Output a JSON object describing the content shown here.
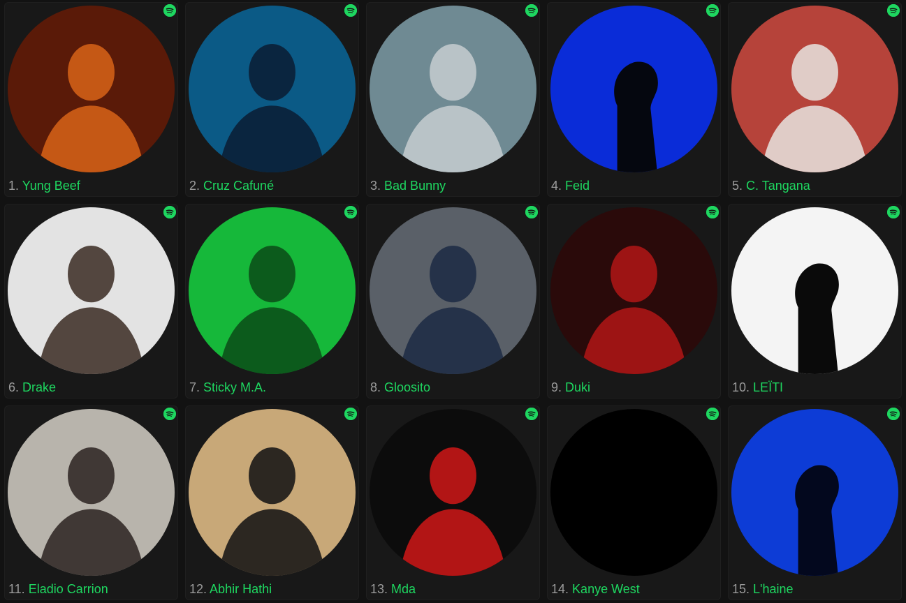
{
  "accent": "#1ed760",
  "rank_color": "#9b9b9b",
  "background": "#121212",
  "card_background": "#181818",
  "badge_icon": "spotify-icon",
  "artists": [
    {
      "rank": "1.",
      "name": "Yung Beef",
      "bg": "#5a1a08",
      "fg": "#d86418",
      "shape": "figure"
    },
    {
      "rank": "2.",
      "name": "Cruz Cafuné",
      "bg": "#0b5a86",
      "fg": "#0a1c33",
      "shape": "figure"
    },
    {
      "rank": "3.",
      "name": "Bad Bunny",
      "bg": "#6f8a93",
      "fg": "#c7ccd0",
      "shape": "figure"
    },
    {
      "rank": "4.",
      "name": "Feid",
      "bg": "#0a2cd8",
      "fg": "#05070f",
      "shape": "silhouette"
    },
    {
      "rank": "5.",
      "name": "C. Tangana",
      "bg": "#b6433a",
      "fg": "#e8e4e0",
      "shape": "figure"
    },
    {
      "rank": "6.",
      "name": "Drake",
      "bg": "#e3e3e3",
      "fg": "#3a2a22",
      "shape": "figure"
    },
    {
      "rank": "7.",
      "name": "Sticky M.A.",
      "bg": "#16b83a",
      "fg": "#0a4a18",
      "shape": "figure"
    },
    {
      "rank": "8.",
      "name": "Gloosito",
      "bg": "#5a6068",
      "fg": "#1c2a44",
      "shape": "figure"
    },
    {
      "rank": "9.",
      "name": "Duki",
      "bg": "#2a0a0a",
      "fg": "#b21616",
      "shape": "figure"
    },
    {
      "rank": "10.",
      "name": "LEÏTI",
      "bg": "#f4f4f4",
      "fg": "#0a0a0a",
      "shape": "silhouette"
    },
    {
      "rank": "11.",
      "name": "Eladio Carrion",
      "bg": "#b8b4ac",
      "fg": "#2a2220",
      "shape": "figure"
    },
    {
      "rank": "12.",
      "name": "Abhir Hathi",
      "bg": "#c8a878",
      "fg": "#101012",
      "shape": "figure"
    },
    {
      "rank": "13.",
      "name": "Mda",
      "bg": "#0c0c0c",
      "fg": "#d01818",
      "shape": "figure"
    },
    {
      "rank": "14.",
      "name": "Kanye West",
      "bg": "#000000",
      "fg": "#000000",
      "shape": "none"
    },
    {
      "rank": "15.",
      "name": "L'haine",
      "bg": "#0d3cd6",
      "fg": "#03081e",
      "shape": "silhouette"
    }
  ]
}
